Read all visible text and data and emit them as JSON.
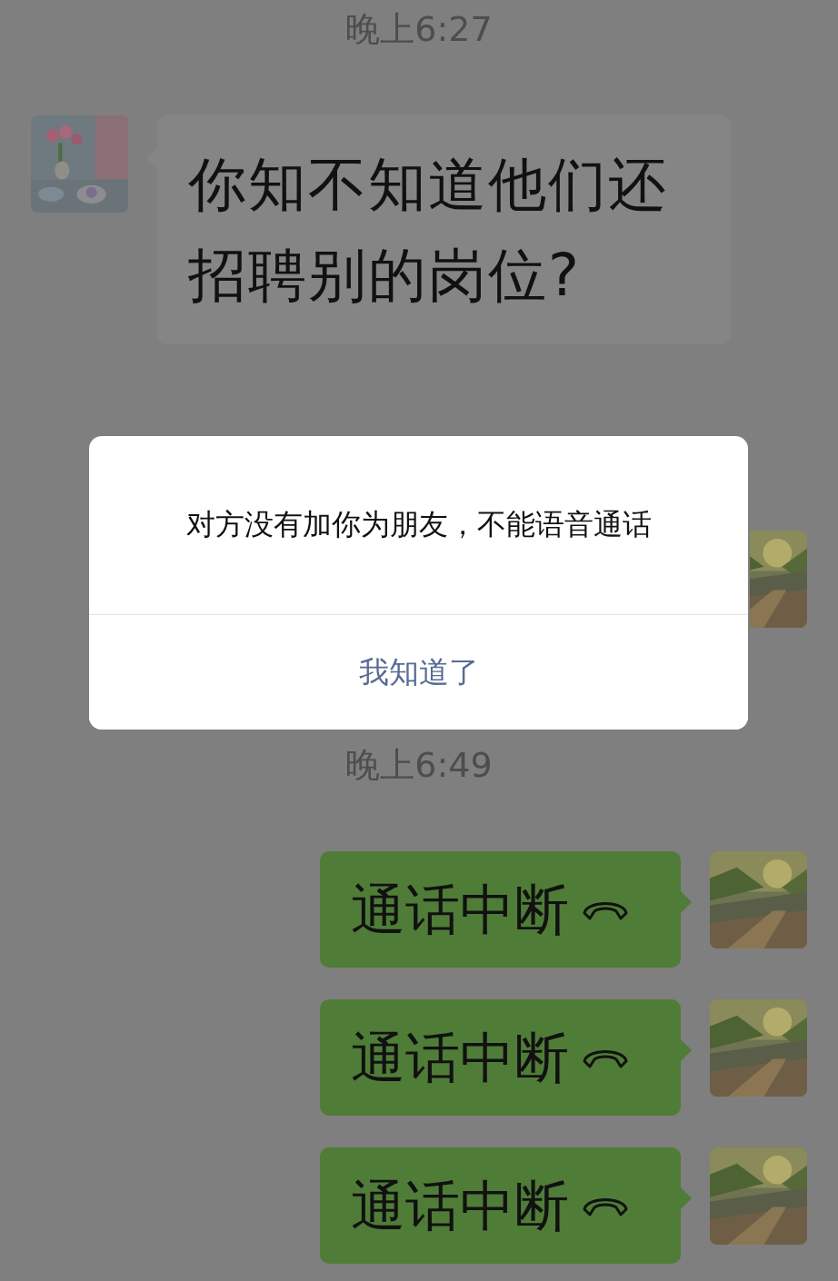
{
  "messages": [
    {
      "kind": "time",
      "text": "晚上6:27"
    },
    {
      "kind": "text",
      "outgoing": false,
      "text": "你知不知道他们还招聘别的岗位?"
    },
    {
      "kind": "avatar_only",
      "outgoing": true
    },
    {
      "kind": "time",
      "text": "晚上6:49"
    },
    {
      "kind": "call",
      "outgoing": true,
      "text": "通话中断"
    },
    {
      "kind": "call",
      "outgoing": true,
      "text": "通话中断"
    },
    {
      "kind": "call",
      "outgoing": true,
      "text": "通话中断"
    }
  ],
  "dialog": {
    "message": "对方没有加你为朋友，不能语音通话",
    "button": "我知道了"
  }
}
